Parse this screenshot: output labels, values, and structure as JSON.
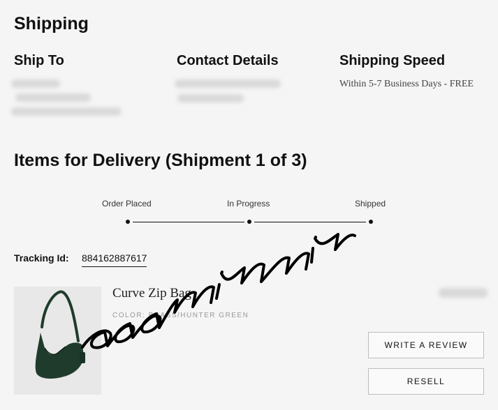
{
  "shipping": {
    "title": "Shipping",
    "ship_to": {
      "heading": "Ship To"
    },
    "contact": {
      "heading": "Contact Details"
    },
    "speed": {
      "heading": "Shipping Speed",
      "value": "Within 5-7 Business Days - FREE"
    }
  },
  "delivery": {
    "title": "Items for Delivery (Shipment 1 of 3)",
    "progress": {
      "steps": [
        "Order Placed",
        "In Progress",
        "Shipped"
      ]
    },
    "tracking": {
      "label": "Tracking Id:",
      "id": "884162887617"
    },
    "item": {
      "name": "Curve Zip Bag",
      "color": "COLOR: BRASS/HUNTER GREEN",
      "image_icon": "handbag-icon",
      "bag_color": "#1f3b2b"
    },
    "buttons": {
      "review": "WRITE A REVIEW",
      "resell": "RESELL"
    }
  },
  "watermark": {
    "text": "aaaminmin"
  }
}
